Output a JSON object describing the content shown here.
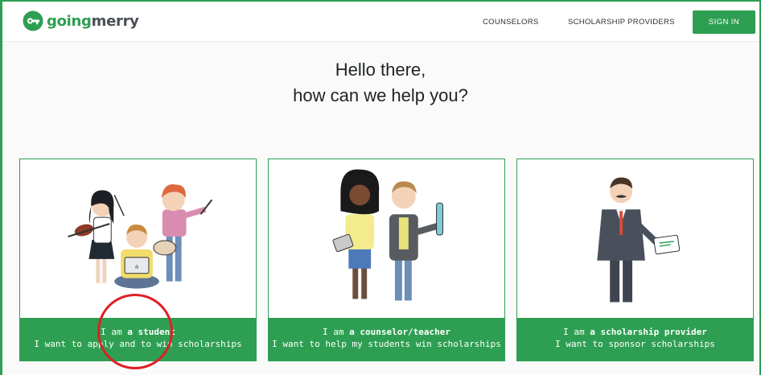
{
  "brand": {
    "part1": "going",
    "part2": "merry",
    "color": "#2e9f52"
  },
  "nav": {
    "counselors": "COUNSELORS",
    "providers": "SCHOLARSHIP PROVIDERS",
    "signin": "SIGN IN"
  },
  "greeting": {
    "line1": "Hello there,",
    "line2": "how can we help you?"
  },
  "cards": [
    {
      "prefix": "I am ",
      "role": "a student",
      "desc": "I want to apply and to win scholarships"
    },
    {
      "prefix": "I am ",
      "role": "a counselor/teacher",
      "desc": "I want to help my students win scholarships"
    },
    {
      "prefix": "I am ",
      "role": "a scholarship provider",
      "desc": "I want to sponsor scholarships"
    }
  ],
  "annotation": {
    "color": "#e01f25"
  }
}
